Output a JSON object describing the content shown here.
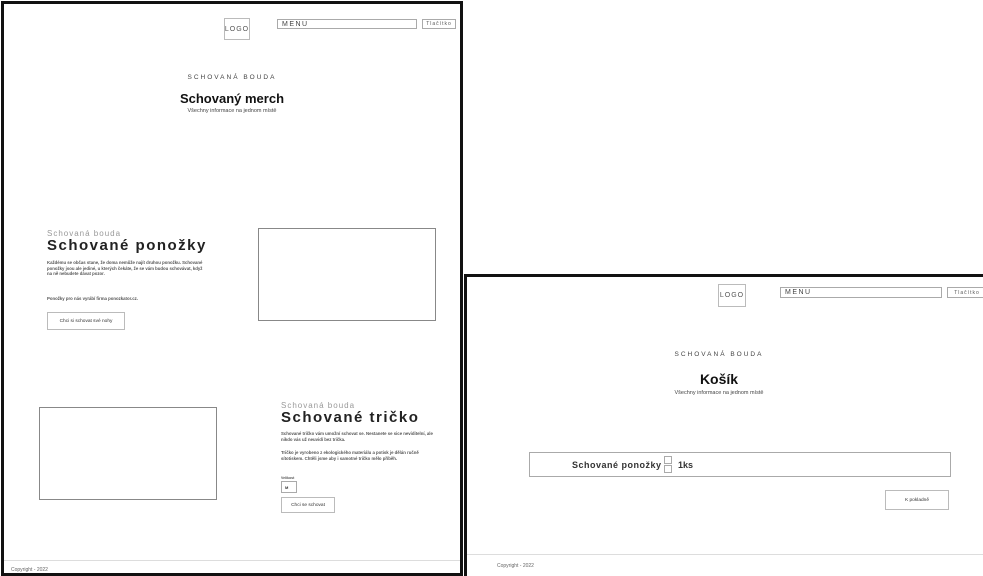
{
  "product_page": {
    "header": {
      "logo": "LOGO",
      "menu": "MENU",
      "button": "Tlačítko"
    },
    "brand": "SCHOVANÁ BOUDA",
    "title": "Schovaný merch",
    "subtitle": "Všechny informace na jednom místě",
    "socks": {
      "kicker": "Schovaná bouda",
      "title": "Schované ponožky",
      "paragraph_1": "Každému se občas stane, že doma nemůže najít druhou ponožku. Schované ponožky jsou ale jediné, u kterých čekáte, že se vám budou schovávat, když na ně nebudete dávat pozor.",
      "paragraph_2": "Ponožky pro nás vyrábí firma ponozkator.cz.",
      "button": "Chci si schovat své nohy"
    },
    "tshirt": {
      "kicker": "Schovaná bouda",
      "title": "Schované tričko",
      "paragraph_1": "Schované tričko vám umožní schovat se. Nestanete se sice neviditelní, ale nikdo vás už neuvidí bez trička.",
      "paragraph_2": "Tričko je vyrobeno z ekologického materiálu a potisk je dělán ručně sítotiskem. Chtěli jsme aby i samotné tričko mělo příběh.",
      "size_label": "Velikost",
      "size_value": "M",
      "button": "Chci se schovat"
    },
    "footer": {
      "copyright": "Copyright - 2022"
    }
  },
  "cart_page": {
    "header": {
      "logo": "LOGO",
      "menu": "MENU",
      "button": "Tlačítko"
    },
    "brand": "SCHOVANÁ BOUDA",
    "title": "Košík",
    "subtitle": "Všechny informace na jednom místě",
    "item": {
      "name": "Schované ponožky",
      "quantity": "1ks"
    },
    "checkout_button": "K pokladně",
    "footer": {
      "copyright": "Copyright - 2022"
    }
  }
}
